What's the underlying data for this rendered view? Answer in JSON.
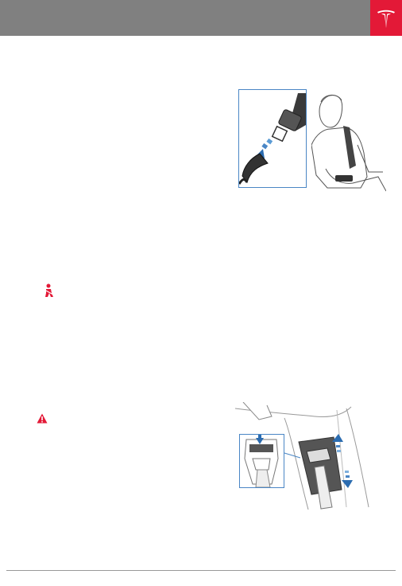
{
  "header": {
    "logo": "tesla-logo-icon",
    "brand_color": "#e31937",
    "bar_color": "#808080"
  },
  "figures": {
    "seatbelt_buckle": {
      "icons": [
        "seatbelt-latch-icon",
        "buckle-arrow-icon",
        "seated-person-icon"
      ]
    },
    "shoulder_anchor": {
      "icons": [
        "anchor-button-icon",
        "slide-up-arrow-icon",
        "slide-down-arrow-icon"
      ]
    }
  },
  "symbols": {
    "seatbelt_reminder": "seatbelt-reminder-icon",
    "warning": "warning-icon",
    "accent_color": "#e31937",
    "diagram_blue": "#2b6cb0"
  }
}
